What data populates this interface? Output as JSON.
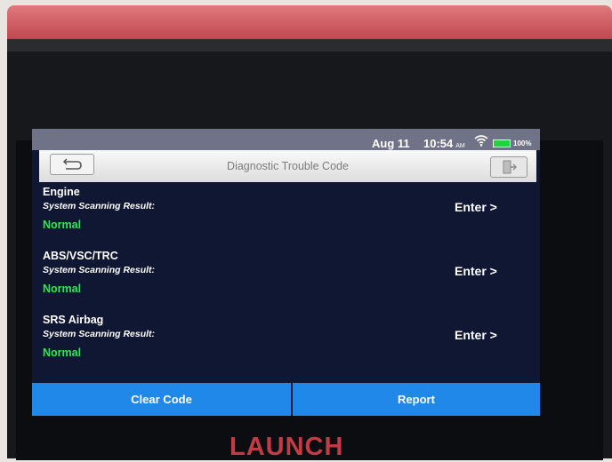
{
  "status_bar": {
    "date": "Aug 11",
    "time": "10:54",
    "time_suffix": "AM",
    "battery": "100%",
    "battery_color": "#1fd33a"
  },
  "title_bar": {
    "title": "Diagnostic Trouble Code",
    "back_icon": "back-arrow-icon",
    "exit_icon": "exit-icon"
  },
  "systems": [
    {
      "name": "Engine",
      "scan_label": "System Scanning Result:",
      "status": "Normal",
      "enter_label": "Enter >"
    },
    {
      "name": "ABS/VSC/TRC",
      "scan_label": "System Scanning Result:",
      "status": "Normal",
      "enter_label": "Enter >"
    },
    {
      "name": "SRS Airbag",
      "scan_label": "System Scanning Result:",
      "status": "Normal",
      "enter_label": "Enter >"
    }
  ],
  "actions": {
    "clear_code": "Clear Code",
    "report": "Report"
  },
  "brand": "LAUNCH",
  "colors": {
    "accent": "#1f88e9",
    "status_ok": "#28ec4e",
    "housing": "#c24a52"
  }
}
